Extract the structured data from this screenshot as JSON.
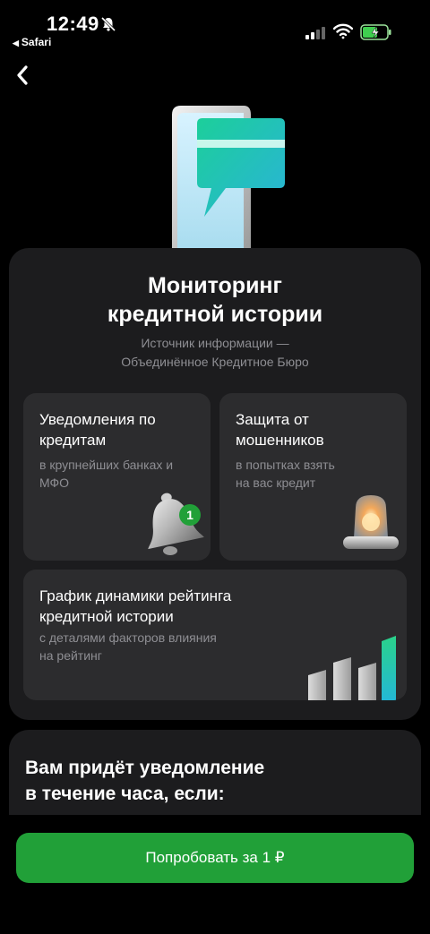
{
  "status_bar": {
    "time": "12:49",
    "back_app": "Safari"
  },
  "header": {
    "back_icon": "chevron-left-icon"
  },
  "panel": {
    "title": "Мониторинг\nкредитной истории",
    "subtitle": "Источник информации —\nОбъединённое Кредитное Бюро"
  },
  "cards": [
    {
      "title": "Уведомления по\nкредитам",
      "desc": "в крупнейших банках и\nМФО",
      "icon": "bell-icon",
      "badge": "1"
    },
    {
      "title": "Защита от\nмошенников",
      "desc": "в попытках взять\nна вас кредит",
      "icon": "siren-icon"
    },
    {
      "title": "График динамики рейтинга\nкредитной истории",
      "desc": "с деталями факторов влияния\nна рейтинг",
      "icon": "bar-chart-icon"
    }
  ],
  "panel_2": {
    "title": "Вам придёт уведомление\nв течение часа, если:"
  },
  "cta": {
    "label": "Попробовать за 1 ₽"
  },
  "colors": {
    "accent": "#21a038",
    "teal": "#20c4a8",
    "card_bg": "#2c2c2e",
    "panel_bg": "#1c1c1e"
  }
}
